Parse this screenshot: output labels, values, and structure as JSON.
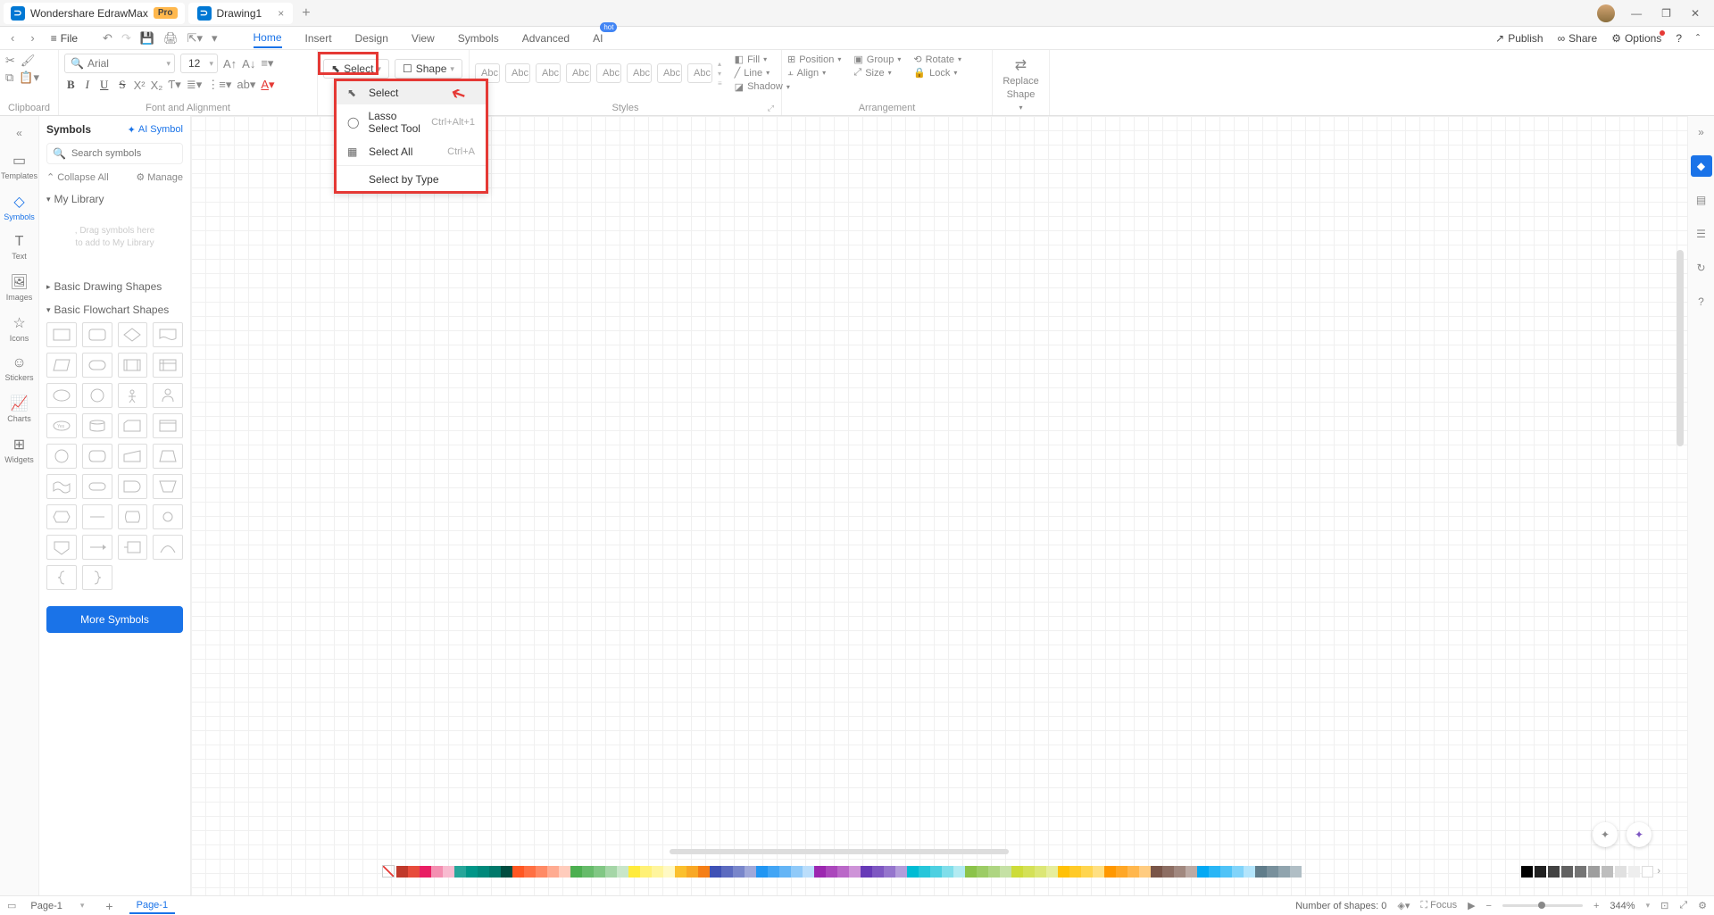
{
  "titlebar": {
    "app_name": "Wondershare EdrawMax",
    "pro": "Pro",
    "doc_name": "Drawing1"
  },
  "menu": {
    "file": "File",
    "tabs": [
      "Home",
      "Insert",
      "Design",
      "View",
      "Symbols",
      "Advanced",
      "AI"
    ],
    "active_tab": "Home",
    "hot": "hot",
    "publish": "Publish",
    "share": "Share",
    "options": "Options"
  },
  "ribbon": {
    "clipboard": {
      "label": "Clipboard"
    },
    "font": {
      "name": "Arial",
      "size": "12",
      "label": "Font and Alignment"
    },
    "select": {
      "label": "Select",
      "shape": "Shape"
    },
    "styles": {
      "label": "Styles",
      "pill": "Abc"
    },
    "fill": "Fill",
    "line": "Line",
    "shadow": "Shadow",
    "position": "Position",
    "align": "Align",
    "group": "Group",
    "size": "Size",
    "rotate": "Rotate",
    "lock": "Lock",
    "replace1": "Replace",
    "replace2": "Shape",
    "arrangement": "Arrangement",
    "replace_label": "Replace"
  },
  "select_dropdown": {
    "items": [
      {
        "label": "Select",
        "shortcut": ""
      },
      {
        "label": "Lasso Select Tool",
        "shortcut": "Ctrl+Alt+1"
      },
      {
        "label": "Select All",
        "shortcut": "Ctrl+A"
      },
      {
        "label": "Select by Type",
        "shortcut": ""
      }
    ]
  },
  "left_rail": {
    "items": [
      {
        "label": "Templates"
      },
      {
        "label": "Symbols"
      },
      {
        "label": "Text"
      },
      {
        "label": "Images"
      },
      {
        "label": "Icons"
      },
      {
        "label": "Stickers"
      },
      {
        "label": "Charts"
      },
      {
        "label": "Widgets"
      }
    ]
  },
  "symbols": {
    "title": "Symbols",
    "ai": "AI Symbol",
    "search_placeholder": "Search symbols",
    "collapse": "Collapse All",
    "manage": "Manage",
    "my_library": "My Library",
    "drag_hint1": "Drag symbols here",
    "drag_hint2": "to add to My Library",
    "basic_drawing": "Basic Drawing Shapes",
    "basic_flowchart": "Basic Flowchart Shapes",
    "more": "More Symbols"
  },
  "statusbar": {
    "page_dropdown": "Page-1",
    "page_tab": "Page-1",
    "shape_count_label": "Number of shapes:",
    "shape_count": "0",
    "focus": "Focus",
    "zoom": "344%"
  },
  "colors": [
    "#c0392b",
    "#e74c3c",
    "#e91e63",
    "#f48fb1",
    "#f8bbd0",
    "#26a69a",
    "#009688",
    "#00897b",
    "#00796b",
    "#004d40",
    "#ff5722",
    "#ff7043",
    "#ff8a65",
    "#ffab91",
    "#ffccbc",
    "#4caf50",
    "#66bb6a",
    "#81c784",
    "#a5d6a7",
    "#c8e6c9",
    "#ffeb3b",
    "#fff176",
    "#fff59d",
    "#fff9c4",
    "#fbc02d",
    "#f9a825",
    "#f57f17",
    "#3f51b5",
    "#5c6bc0",
    "#7986cb",
    "#9fa8da",
    "#2196f3",
    "#42a5f5",
    "#64b5f6",
    "#90caf9",
    "#bbdefb",
    "#9c27b0",
    "#ab47bc",
    "#ba68c8",
    "#ce93d8",
    "#673ab7",
    "#7e57c2",
    "#9575cd",
    "#b39ddb",
    "#00bcd4",
    "#26c6da",
    "#4dd0e1",
    "#80deea",
    "#b2ebf2",
    "#8bc34a",
    "#9ccc65",
    "#aed581",
    "#c5e1a5",
    "#cddc39",
    "#d4e157",
    "#dce775",
    "#e6ee9c",
    "#ffc107",
    "#ffca28",
    "#ffd54f",
    "#ffe082",
    "#ff9800",
    "#ffa726",
    "#ffb74d",
    "#ffcc80",
    "#795548",
    "#8d6e63",
    "#a1887f",
    "#bcaaa4",
    "#03a9f4",
    "#29b6f6",
    "#4fc3f7",
    "#81d4fa",
    "#b3e5fc",
    "#607d8b",
    "#78909c",
    "#90a4ae",
    "#b0bec5"
  ],
  "grays": [
    "#000000",
    "#212121",
    "#424242",
    "#616161",
    "#757575",
    "#9e9e9e",
    "#bdbdbd",
    "#e0e0e0",
    "#eeeeee",
    "#ffffff"
  ]
}
